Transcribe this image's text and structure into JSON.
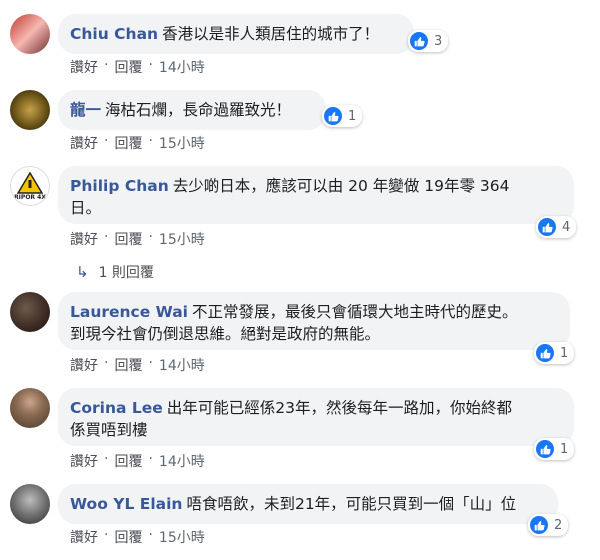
{
  "comments": [
    {
      "name": "Chiu Chan",
      "text": "香港以是非人類居住的城市了！",
      "reactions": "3",
      "like": "讚好",
      "reply": "回覆",
      "time": "14小時"
    },
    {
      "name": "龍一",
      "text": "海枯石爛，長命過羅致光！",
      "reactions": "1",
      "like": "讚好",
      "reply": "回覆",
      "time": "15小時"
    },
    {
      "name": "Philip Chan",
      "text_line1": "去少啲日本，應該可以由 20 年變做 19年零 364",
      "text_line2": "日。",
      "reactions": "4",
      "like": "讚好",
      "reply": "回覆",
      "time": "15小時",
      "replies": "1 則回覆",
      "avatar_text": "RIPOR 4X"
    },
    {
      "name": "Laurence Wai",
      "text_line1": "不正常發展，最後只會循環大地主時代的歷史。",
      "text_line2": "到現今社會仍倒退思維。絕對是政府的無能。",
      "reactions": "1",
      "like": "讚好",
      "reply": "回覆",
      "time": "14小時"
    },
    {
      "name": "Corina Lee",
      "text_line1": "出年可能已經係23年，然後每年一路加，你始終都",
      "text_line2": "係買唔到樓",
      "reactions": "1",
      "like": "讚好",
      "reply": "回覆",
      "time": "14小時"
    },
    {
      "name": "Woo YL Elain",
      "text": "唔食唔飲，未到21年，可能只買到一個「山」位",
      "reactions": "2",
      "like": "讚好",
      "reply": "回覆",
      "time": "15小時"
    }
  ],
  "colors": {
    "link": "#385898",
    "bubble": "#f2f3f5",
    "like": "#1877f2"
  },
  "icons": {
    "like": "thumbs-up-icon",
    "reply_arrow": "reply-arrow-icon"
  }
}
